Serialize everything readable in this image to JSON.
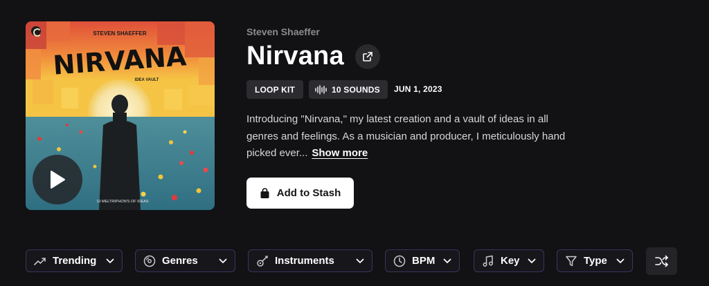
{
  "cover": {
    "artist_text": "STEVEN SHAEFFER",
    "title_text": "NIRVANA",
    "subtitle_text": "IDEA VAULT",
    "footer_text": "10 MELTRIPHON'S OF IDEAS"
  },
  "release": {
    "artist": "Steven Shaeffer",
    "title": "Nirvana",
    "type_badge": "LOOP KIT",
    "sounds_badge": "10 SOUNDS",
    "date": "JUN 1, 2023",
    "description": "Introducing \"Nirvana,\" my latest creation and a vault of ideas in all genres and feelings. As a musician and producer, I meticulously hand picked ever...",
    "show_more": "Show more"
  },
  "actions": {
    "add_to_stash": "Add to Stash"
  },
  "filters": [
    {
      "label": "Trending",
      "icon": "trending-icon"
    },
    {
      "label": "Genres",
      "icon": "genres-icon"
    },
    {
      "label": "Instruments",
      "icon": "instruments-icon"
    },
    {
      "label": "BPM",
      "icon": "clock-icon"
    },
    {
      "label": "Key",
      "icon": "music-note-icon"
    },
    {
      "label": "Type",
      "icon": "funnel-icon"
    }
  ],
  "colors": {
    "background": "#121113",
    "filter_border": "#3d3462",
    "chip_bg": "#2c2b2f",
    "muted_text": "#8b8b90"
  }
}
